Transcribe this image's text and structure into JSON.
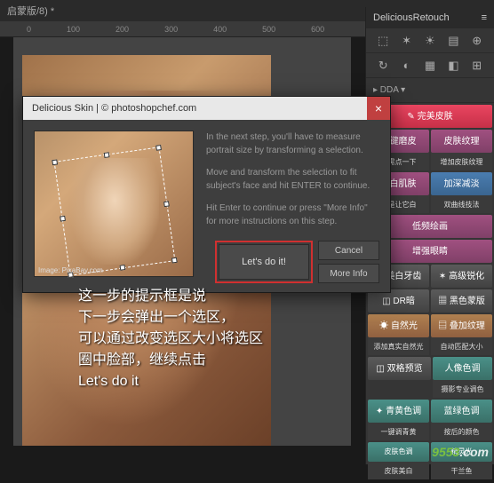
{
  "tab": {
    "title": "启蒙版/8) *"
  },
  "ruler": {
    "marks": [
      "0",
      "100",
      "200",
      "300",
      "400",
      "500",
      "600"
    ]
  },
  "panel": {
    "title": "DeliciousRetouch",
    "menu_glyph": "≡",
    "tool_icons": [
      "⬚",
      "✶",
      "☀",
      "▤",
      "⊕"
    ],
    "tool_icons2": [
      "↻",
      "◐",
      "▦",
      "◧",
      "⊞"
    ],
    "dra": "▸ DDA ▾",
    "buttons": {
      "perfect_skin": "✎ 完美皮肤",
      "one_key": "一键磨皮",
      "one_key_sub": "只需点一下",
      "skin_texture": "皮肤纹理",
      "skin_texture_sub": "增加皮肤纹理",
      "whiten": "美白肌肤",
      "whiten_sub": "就是让它白",
      "dodge_burn": "加深减淡",
      "dodge_burn_sub": "双曲线技法",
      "low_freq": "低频绘画",
      "enhance_eye": "增强眼睛",
      "white_teeth": "⚙ 美白牙齿",
      "sharpen": "✶ 高级锐化",
      "dr_op": "◫ DR暗",
      "mask": "▦ 黑色蒙版",
      "natural": "☀ 自然光",
      "natural_sub": "添加真实自然光",
      "overlay": "▤ 叠加纹理",
      "overlay_sub": "自动匹配大小",
      "preview": "◫ 双格预览",
      "portrait_color": "人像色调",
      "portrait_sub": "摄影专业调色",
      "cyan": "✦ 青黄色调",
      "cyan_sub": "一键调青黄",
      "blue_green": "蓝绿色调",
      "blue_green_sub": "按后的颜色",
      "foot1": "皮肤色调",
      "foot1_sub": "皮肤美白",
      "foot2": "精灵光",
      "foot2_sub": "干兰鱼"
    }
  },
  "dialog": {
    "title": "Delicious Skin | © photoshopchef.com",
    "close": "×",
    "p1": "In the next step, you'll have to measure portrait size by transforming a selection.",
    "p2": "Move and transform the selection to fit subject's face and hit ENTER to continue.",
    "p3": "Hit Enter to continue or press \"More Info\" for more instructions on this step.",
    "credit": "Image: PixaBay.com",
    "primary": "Let's do it!",
    "cancel": "Cancel",
    "more": "More Info"
  },
  "overlay": {
    "l1": "这一步的提示框是说",
    "l2": "下一步会弹出一个选区，",
    "l3": "可以通过改变选区大小将选区",
    "l4": "圈中脸部，继续点击",
    "l5": "Let's do it"
  },
  "watermark": {
    "text": "9553",
    "suffix": ".com"
  }
}
